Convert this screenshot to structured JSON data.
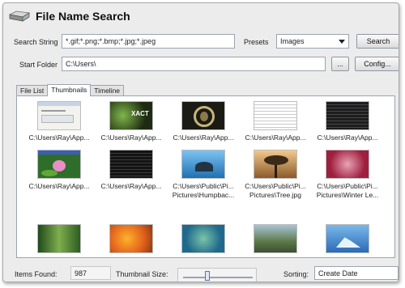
{
  "app": {
    "title": "File Name Search"
  },
  "form": {
    "search_string_label": "Search String",
    "search_string_value": "*.gif;*.png;*.bmp;*.jpg;*.jpeg",
    "presets_label": "Presets",
    "presets_value": "Images",
    "search_button": "Search",
    "start_folder_label": "Start Folder",
    "start_folder_value": "C:\\Users\\",
    "browse_button": "...",
    "config_button": "Config..."
  },
  "tabs": [
    {
      "label": "File List",
      "active": false
    },
    {
      "label": "Thumbnails",
      "active": true
    },
    {
      "label": "Timeline",
      "active": false
    }
  ],
  "thumbnails": [
    {
      "caption": "C:\\Users\\Ray\\App...",
      "caption2": "",
      "art": "screenshot-light"
    },
    {
      "caption": "C:\\Users\\Ray\\App...",
      "caption2": "",
      "art": "xact-logo"
    },
    {
      "caption": "C:\\Users\\Ray\\App...",
      "caption2": "",
      "art": "dark-emblem"
    },
    {
      "caption": "C:\\Users\\Ray\\App...",
      "caption2": "",
      "art": "document-list"
    },
    {
      "caption": "C:\\Users\\Ray\\App...",
      "caption2": "",
      "art": "dark-window"
    },
    {
      "caption": "C:\\Users\\Ray\\App...",
      "caption2": "",
      "art": "lily-pads"
    },
    {
      "caption": "C:\\Users\\Ray\\App...",
      "caption2": "",
      "art": "dark-window"
    },
    {
      "caption": "C:\\Users\\Public\\Pi...",
      "caption2": "Pictures\\Humpbac...",
      "art": "whale"
    },
    {
      "caption": "C:\\Users\\Public\\Pi...",
      "caption2": "Pictures\\Tree.jpg",
      "art": "tree"
    },
    {
      "caption": "C:\\Users\\Public\\Pi...",
      "caption2": "Pictures\\Winter Le...",
      "art": "red-leaves"
    },
    {
      "caption": "",
      "caption2": "",
      "art": "forest"
    },
    {
      "caption": "",
      "caption2": "",
      "art": "flowers"
    },
    {
      "caption": "",
      "caption2": "",
      "art": "turtle"
    },
    {
      "caption": "",
      "caption2": "",
      "art": "river"
    },
    {
      "caption": "",
      "caption2": "",
      "art": "iceberg"
    }
  ],
  "status": {
    "items_found_label": "Items Found:",
    "items_found_value": "987",
    "thumbnail_size_label": "Thumbnail Size:",
    "thumbnail_size_fraction": 0.35,
    "sorting_label": "Sorting:",
    "sorting_value": "Create Date"
  }
}
